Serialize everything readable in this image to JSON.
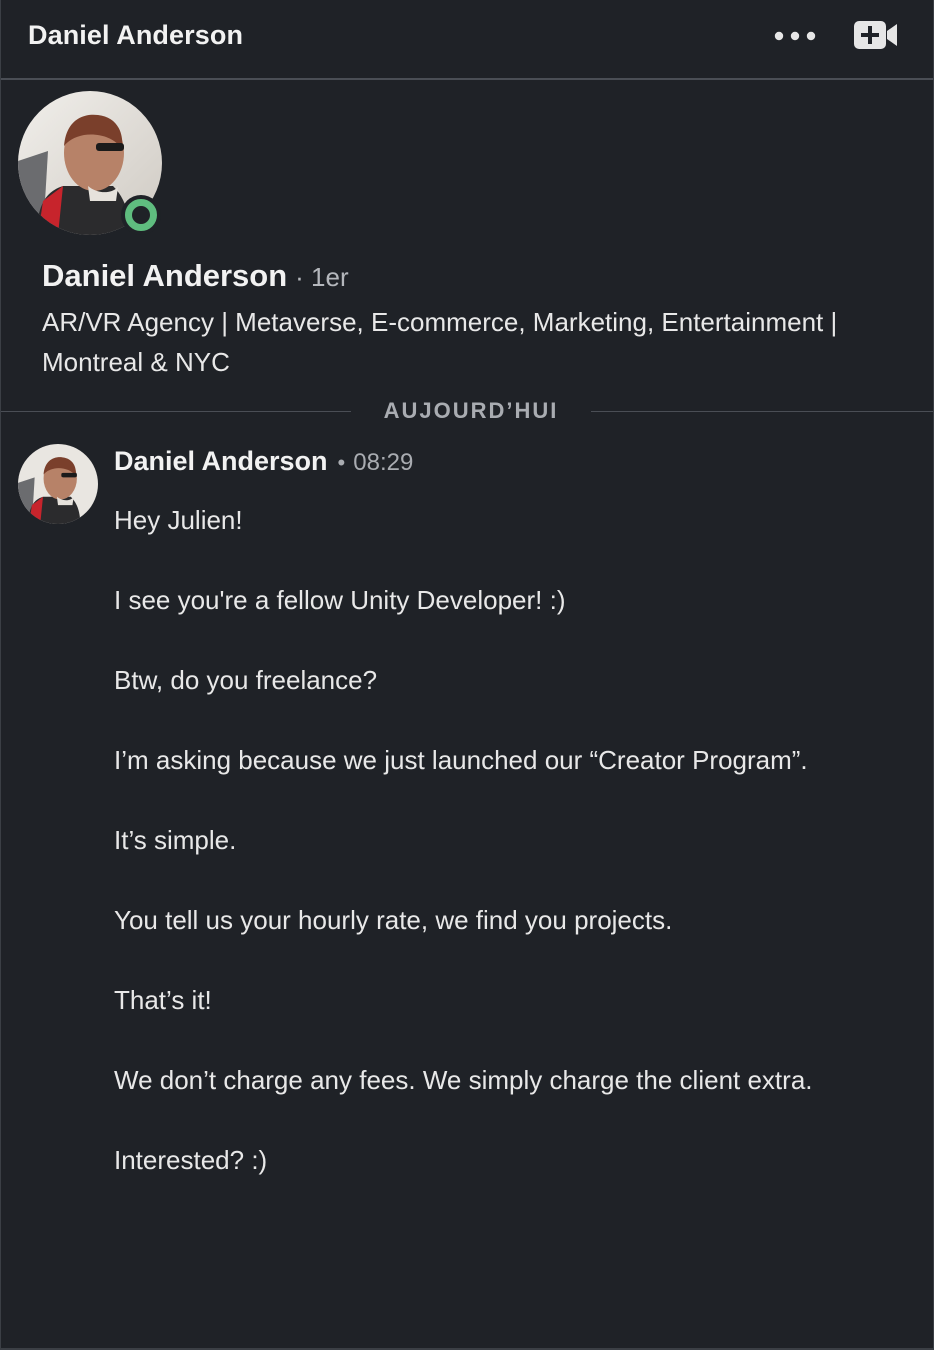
{
  "header": {
    "title": "Daniel Anderson",
    "more_icon": "more-horizontal-icon",
    "video_icon": "video-call-icon"
  },
  "profile": {
    "name": "Daniel Anderson",
    "degree": "· 1er",
    "headline": "AR/VR Agency | Metaverse, E-commerce, Marketing, Entertainment | Montreal & NYC",
    "presence": "online",
    "presence_color": "#5fbd7f"
  },
  "divider": {
    "label": "AUJOURD’HUI"
  },
  "message": {
    "sender": "Daniel Anderson",
    "separator": "•",
    "time": "08:29",
    "paragraphs": [
      "Hey Julien!",
      "I see you're a fellow Unity Developer! :)",
      "Btw, do you freelance?",
      "I’m asking because we just launched our “Creator Program”.",
      "It’s simple.",
      "You tell us your hourly rate, we find you projects.",
      "That’s it!",
      "We don’t charge any fees. We simply charge the client extra.",
      "Interested? :)"
    ]
  },
  "colors": {
    "background": "#1f2227",
    "text": "#e8e8e8",
    "muted": "#a9acb1",
    "online": "#5fbd7f"
  }
}
